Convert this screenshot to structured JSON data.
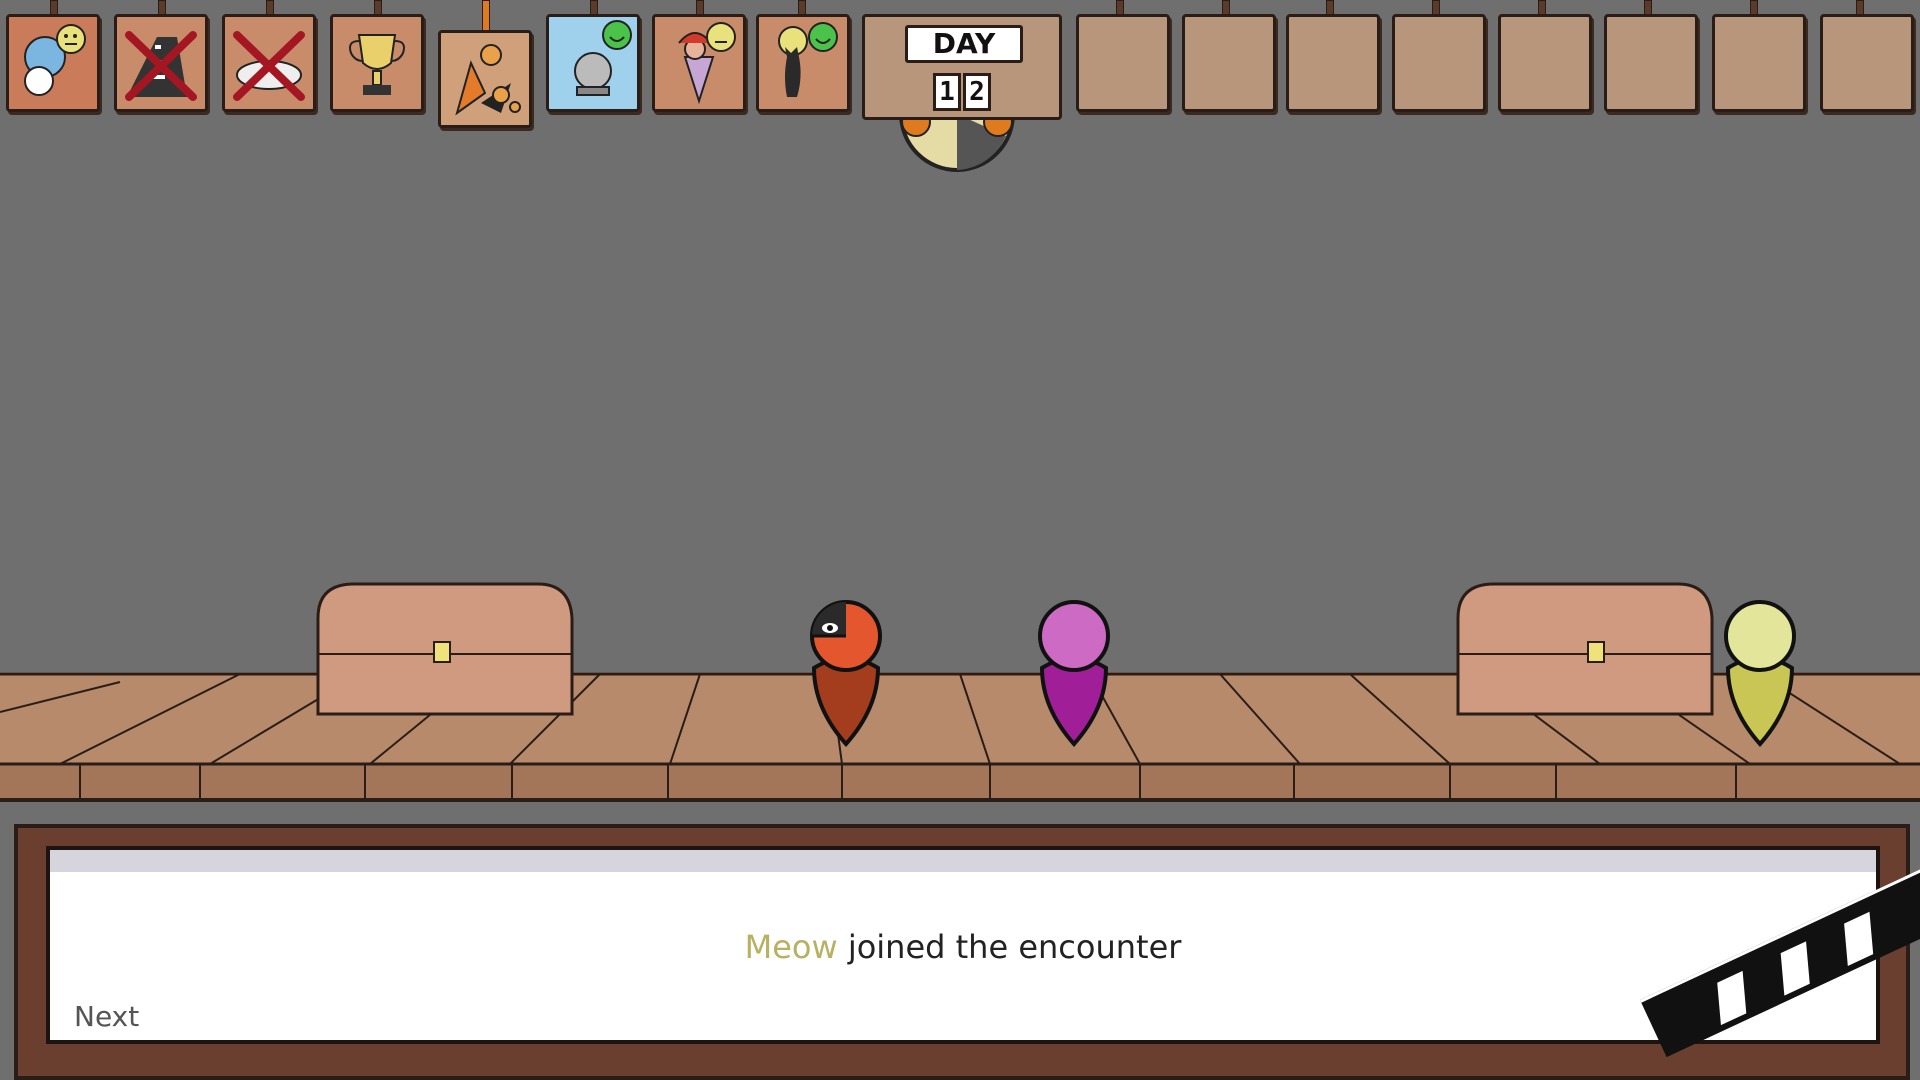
{
  "hud": {
    "day_label": "DAY",
    "day_digits": [
      "1",
      "2"
    ],
    "cards": [
      {
        "name": "portrait-card-blue",
        "mood": "neutral"
      },
      {
        "name": "card-crossed-road",
        "crossed": true
      },
      {
        "name": "card-crossed-plate",
        "crossed": true
      },
      {
        "name": "trophy-card"
      },
      {
        "name": "active-encounter-card",
        "active": true
      },
      {
        "name": "crystal-ball-card",
        "mood": "happy"
      },
      {
        "name": "portrait-card-witch",
        "mood": "neutral"
      },
      {
        "name": "portrait-card-cat",
        "mood": "happy"
      }
    ],
    "empty_slots": 8
  },
  "dialog": {
    "speaker": "Meow",
    "message": " joined the encounter",
    "next_label": "Next"
  },
  "colors": {
    "background": "#6f6f6f",
    "floor": "#b68a6b",
    "pawn_orange": "#e4572e",
    "pawn_magenta": "#b02aa6",
    "pawn_yellow": "#c9c655",
    "speaker_name": "#b8b062"
  }
}
